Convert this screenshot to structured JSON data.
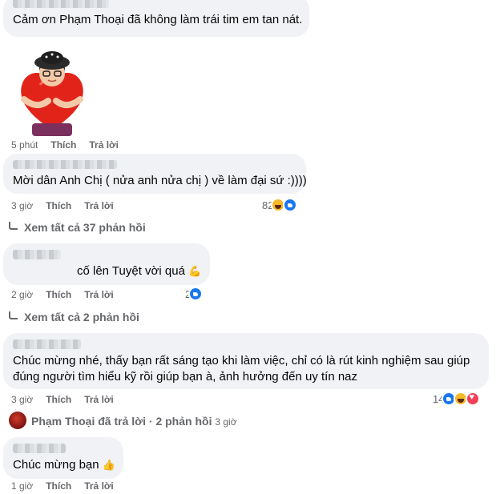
{
  "comments": [
    {
      "text": "Cảm ơn Phạm Thoại đã không làm trái tim em tan nát."
    },
    {
      "meta": {
        "time": "5 phút",
        "like": "Thích",
        "reply": "Trả lời"
      }
    },
    {
      "text": "Mời dân Anh Chị ( nửa anh nửa chị ) về làm đại sứ :))))",
      "meta": {
        "time": "3 giờ",
        "like": "Thích",
        "reply": "Trả lời"
      },
      "reactions": {
        "count": "82",
        "icons": [
          "haha-icon",
          "like-icon"
        ]
      },
      "view_replies": "Xem tất cả 37 phản hồi"
    },
    {
      "text": "cố lên Tuyệt vời quá",
      "emoji": "💪",
      "meta": {
        "time": "2 giờ",
        "like": "Thích",
        "reply": "Trả lời"
      },
      "reactions": {
        "count": "2",
        "icons": [
          "like-icon"
        ]
      },
      "view_replies": "Xem tất cả 2 phản hồi"
    },
    {
      "text_line1": "Chúc mừng nhé, thấy bạn rất sáng tạo khi làm việc, chỉ có là rút kinh nghiệm sau giúp",
      "text_line2": "đúng người tìm hiểu kỹ rồi giúp bạn à, ảnh hưởng đến uy tín naz",
      "meta": {
        "time": "3 giờ",
        "like": "Thích",
        "reply": "Trả lời"
      },
      "reactions": {
        "count": "14",
        "icons": [
          "like-icon",
          "haha-icon",
          "love-icon"
        ]
      },
      "author_reply": {
        "name": "Phạm Thoại",
        "action": "đã trả lời",
        "sep": "·",
        "replies": "2 phản hồi",
        "time": "3 giờ"
      }
    },
    {
      "text": "Chúc mừng bạn",
      "emoji": "👍",
      "meta": {
        "time": "1 giờ",
        "like": "Thích",
        "reply": "Trả lời"
      }
    }
  ],
  "colors": {
    "bubble": "#f0f2f5",
    "meta": "#65676b",
    "like": "#1877f2",
    "haha": "#f7b928",
    "love": "#f33e58"
  }
}
